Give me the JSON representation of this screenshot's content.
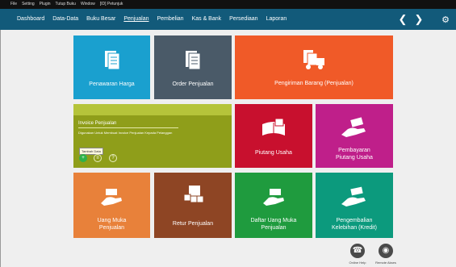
{
  "menubar": {
    "items": [
      "File",
      "Setting",
      "Plugin",
      "Tutup Buku",
      "Window",
      "[ID] Petunjuk"
    ]
  },
  "nav": {
    "tabs": [
      "Dashboard",
      "Data-Data",
      "Buku Besar",
      "Penjualan",
      "Pembelian",
      "Kas & Bank",
      "Persediaan",
      "Laporan"
    ],
    "active_tab": "Penjualan"
  },
  "tiles": {
    "penawaran": "Penawaran Harga",
    "order": "Order Penjualan",
    "pengiriman": "Pengiriman Barang (Penjualan)",
    "invoice": {
      "title": "Invoice Penjualan",
      "description": "Digunakan Untuk Membuat Invoice Penjualan Kepada Pelanggan",
      "tooltip": "Tambah Data"
    },
    "piutang": "Piutang Usaha",
    "pembayaran_1": "Pembayaran",
    "pembayaran_2": "Piutang Usaha",
    "uangmuka_1": "Uang Muka",
    "uangmuka_2": "Penjualan",
    "retur": "Retur Penjualan",
    "daftar_1": "Daftar Uang Muka",
    "daftar_2": "Penjualan",
    "pengembalian_1": "Pengembalian",
    "pengembalian_2": "Kelebihan (Kredit)"
  },
  "footer": {
    "online_help": "Online Help",
    "remote_akses": "Remote Akses"
  },
  "colors": {
    "navbar": "#125a7a",
    "penawaran": "#1aa0cf",
    "order": "#4a5a68",
    "pengiriman": "#f05a28",
    "invoice": "#8f9e1a",
    "piutang": "#c8102e",
    "pembayaran": "#bf1f8a",
    "uangmuka": "#e8813a",
    "retur": "#8e4524",
    "daftar": "#1f9b3e",
    "pengembalian": "#0c9a7d"
  },
  "icons": [
    "settings-gear-icon",
    "back-arrow-icon",
    "forward-arrow-icon",
    "phone-icon",
    "remote-globe-icon",
    "add-icon",
    "list-icon",
    "help-icon"
  ]
}
